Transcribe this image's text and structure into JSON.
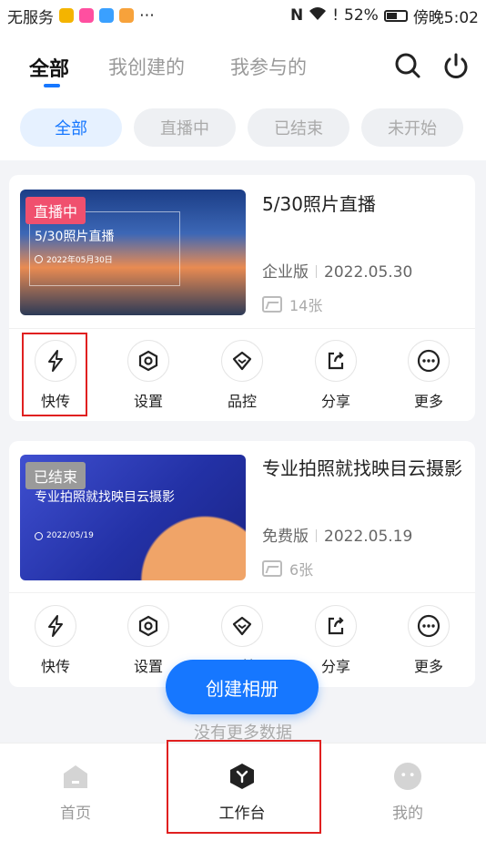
{
  "status_bar": {
    "carrier": "无服务",
    "battery": "52%",
    "time": "傍晚5:02"
  },
  "header": {
    "tabs": [
      {
        "label": "全部",
        "active": true
      },
      {
        "label": "我创建的",
        "active": false
      },
      {
        "label": "我参与的",
        "active": false
      }
    ],
    "icons": [
      "search-icon",
      "power-icon"
    ]
  },
  "filters": [
    {
      "label": "全部",
      "active": true
    },
    {
      "label": "直播中",
      "active": false
    },
    {
      "label": "已结束",
      "active": false
    },
    {
      "label": "未开始",
      "active": false
    }
  ],
  "albums": [
    {
      "status": "直播中",
      "thumb_title": "5/30照片直播",
      "thumb_date": "2022年05月30日",
      "title": "5/30照片直播",
      "edition": "企业版",
      "date": "2022.05.30",
      "count": "14张"
    },
    {
      "status": "已结束",
      "thumb_title": "专业拍照就找映目云摄影",
      "thumb_date": "2022/05/19",
      "title": "专业拍照就找映目云摄影",
      "edition": "免费版",
      "date": "2022.05.19",
      "count": "6张"
    }
  ],
  "actions": [
    {
      "label": "快传",
      "icon": "lightning-icon"
    },
    {
      "label": "设置",
      "icon": "settings-icon"
    },
    {
      "label": "品控",
      "icon": "quality-icon"
    },
    {
      "label": "分享",
      "icon": "share-icon"
    },
    {
      "label": "更多",
      "icon": "more-icon"
    }
  ],
  "create_button": "创建相册",
  "no_more": "没有更多数据",
  "tabbar": [
    {
      "label": "首页",
      "icon": "home-icon",
      "active": false
    },
    {
      "label": "工作台",
      "icon": "workbench-icon",
      "active": true
    },
    {
      "label": "我的",
      "icon": "profile-icon",
      "active": false
    }
  ],
  "colors": {
    "accent": "#1677ff",
    "live_badge": "#f0506e",
    "ended_badge": "#9a9a9a",
    "highlight": "#e02020"
  }
}
